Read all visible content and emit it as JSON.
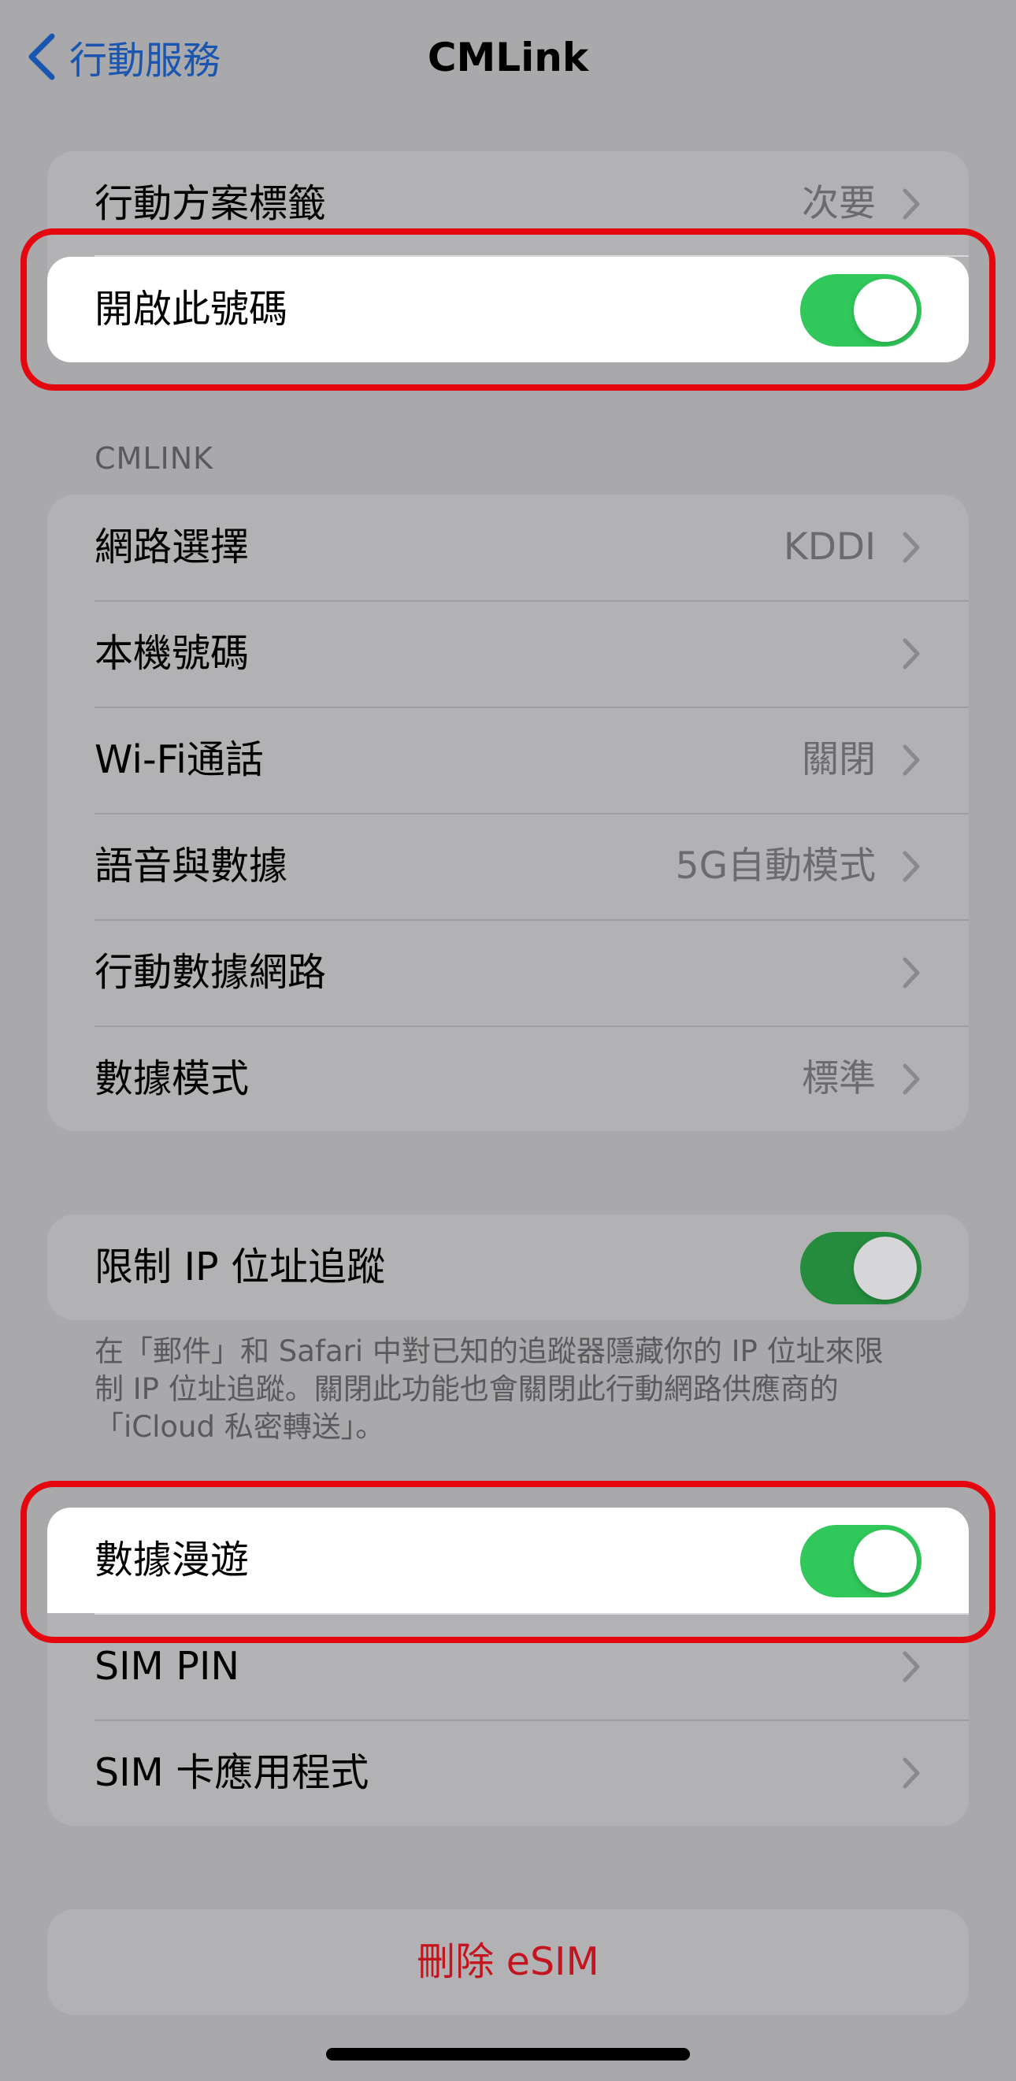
{
  "nav": {
    "back_label": "行動服務",
    "title": "CMLink"
  },
  "group1": {
    "plan_label": {
      "label": "行動方案標籤",
      "value": "次要"
    },
    "turn_on_line": {
      "label": "開啟此號碼",
      "on": true
    }
  },
  "section_header": "CMLINK",
  "group2": {
    "items": [
      {
        "label": "網路選擇",
        "value": "KDDI"
      },
      {
        "label": "本機號碼",
        "value": ""
      },
      {
        "label": "Wi-Fi通話",
        "value": "關閉"
      },
      {
        "label": "語音與數據",
        "value": "5G自動模式"
      },
      {
        "label": "行動數據網路",
        "value": ""
      },
      {
        "label": "數據模式",
        "value": "標準"
      }
    ]
  },
  "group3": {
    "limit_ip": {
      "label": "限制 IP 位址追蹤",
      "on": true
    },
    "footer": "在「郵件」和 Safari 中對已知的追蹤器隱藏你的 IP 位址來限制 IP 位址追蹤。關閉此功能也會關閉此行動網路供應商的「iCloud 私密轉送」。"
  },
  "group4": {
    "roaming": {
      "label": "數據漫遊",
      "on": true
    },
    "sim_pin": {
      "label": "SIM PIN"
    },
    "sim_apps": {
      "label": "SIM 卡應用程式"
    }
  },
  "delete_esim": "刪除 eSIM",
  "colors": {
    "accent": "#1a56b0",
    "toggle_on": "#30c85a",
    "destructive": "#c4151f",
    "highlight": "#e4070f"
  }
}
